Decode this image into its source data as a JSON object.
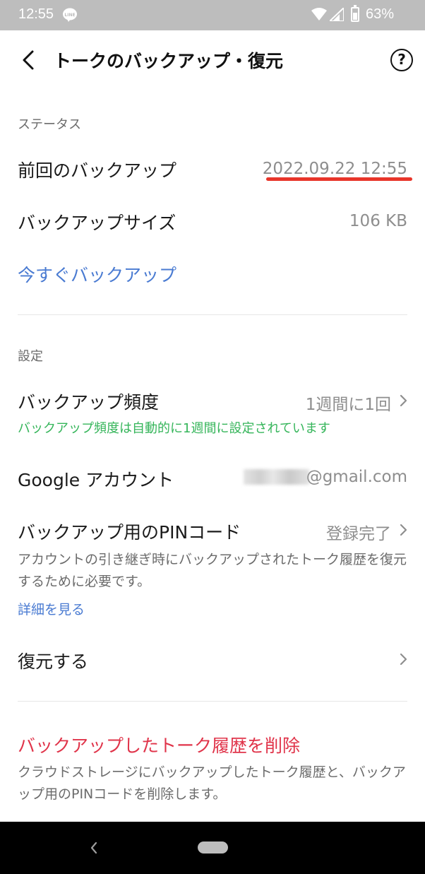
{
  "status_bar": {
    "time": "12:55",
    "battery": "63%",
    "icons": [
      "line-icon",
      "wifi-icon",
      "signal-icon",
      "battery-icon"
    ]
  },
  "header": {
    "title": "トークのバックアップ・復元",
    "back_icon": "chevron-left-icon",
    "help_icon": "help-circle-icon",
    "help_glyph": "?"
  },
  "status_section": {
    "label": "ステータス",
    "last_backup_label": "前回のバックアップ",
    "last_backup_value": "2022.09.22 12:55",
    "backup_size_label": "バックアップサイズ",
    "backup_size_value": "106 KB",
    "backup_now_label": "今すぐバックアップ"
  },
  "settings_section": {
    "label": "設定",
    "frequency_label": "バックアップ頻度",
    "frequency_value": "1週間に1回",
    "frequency_note": "バックアップ頻度は自動的に1週間に設定されています",
    "google_account_label": "Google アカウント",
    "google_account_value": "@gmail.com",
    "pin_label": "バックアップ用のPINコード",
    "pin_value": "登録完了",
    "pin_description": "アカウントの引き継ぎ時にバックアップされたトーク履歴を復元するために必要です。",
    "pin_details_link": "詳細を見る",
    "restore_label": "復元する"
  },
  "delete_section": {
    "label": "バックアップしたトーク履歴を削除",
    "description": "クラウドストレージにバックアップしたトーク履歴と、バックアップ用のPINコードを削除します。"
  },
  "colors": {
    "accent_blue": "#4a7bd2",
    "note_green": "#35b55a",
    "danger_red": "#e0344a",
    "highlight_underline": "#e8352a",
    "status_bar": "#bdbdbd"
  }
}
